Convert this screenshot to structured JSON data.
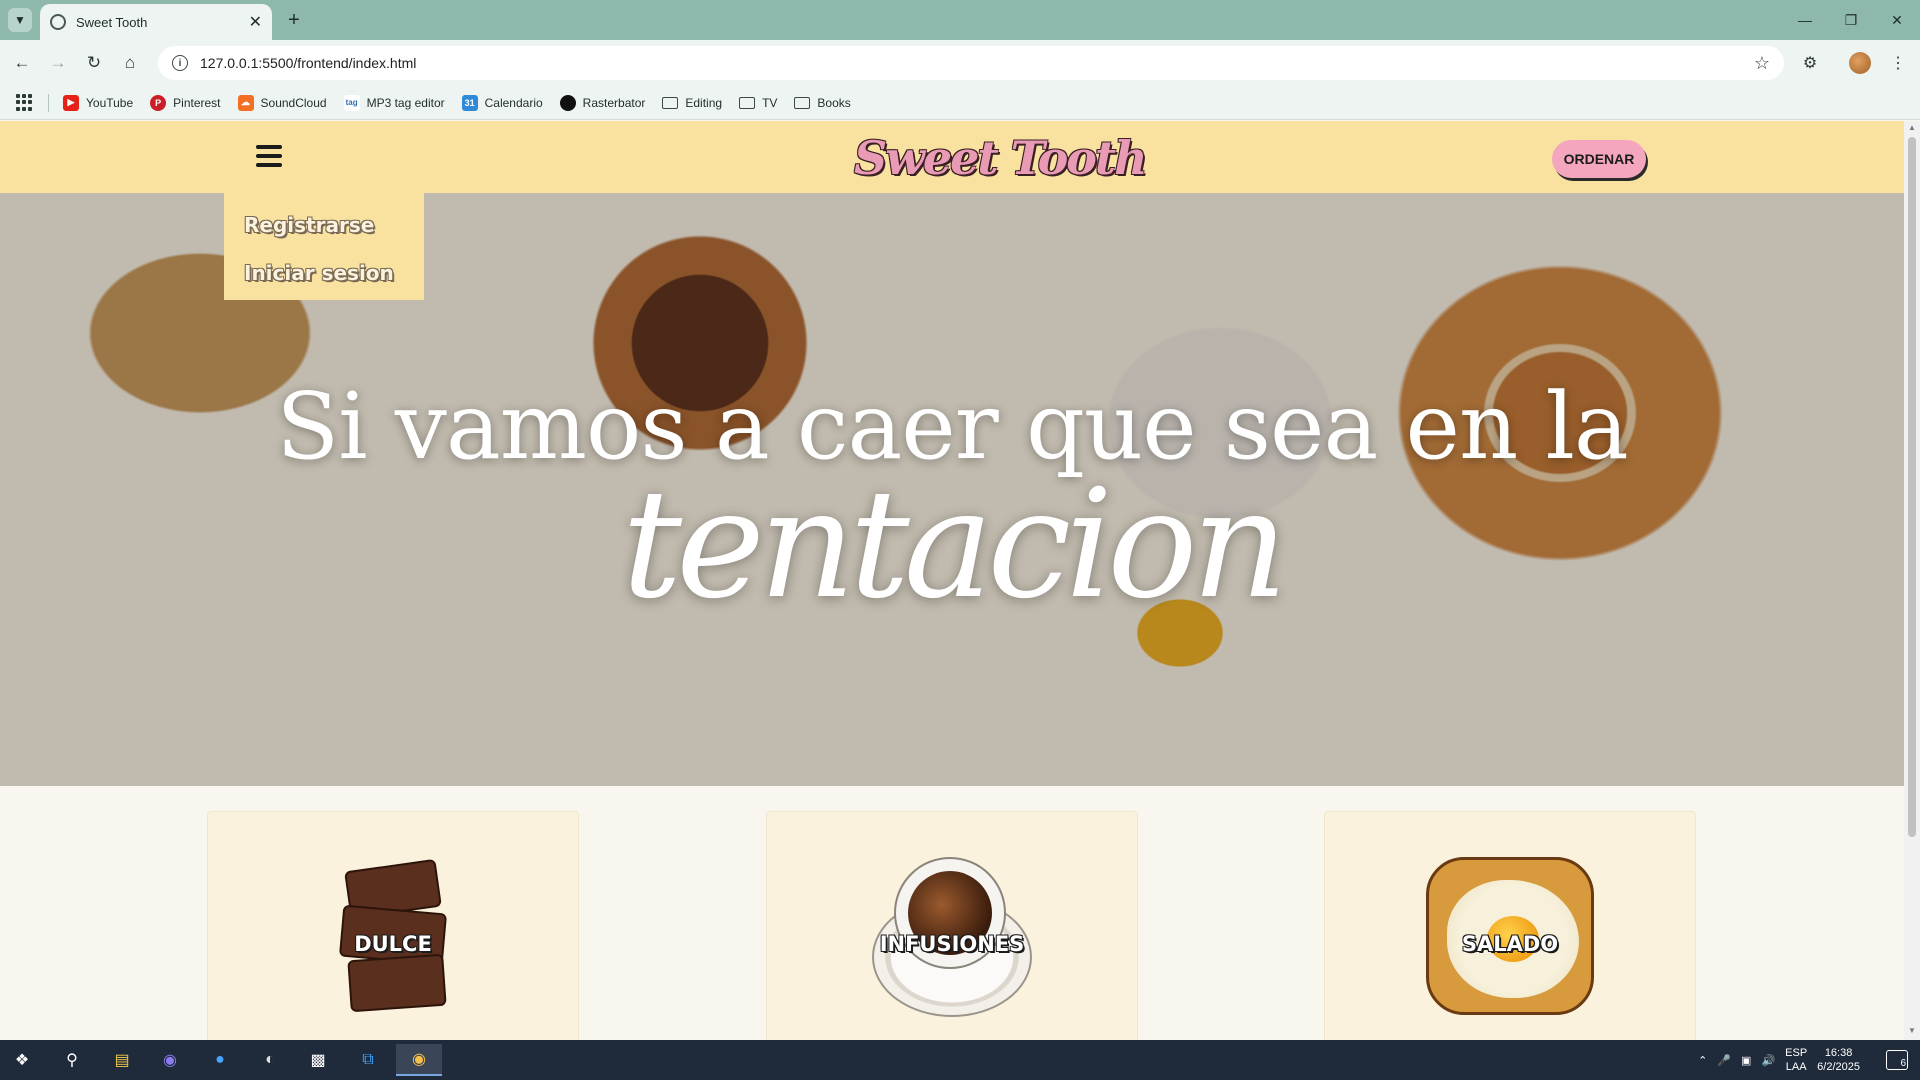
{
  "browser": {
    "tab_title": "Sweet Tooth",
    "address": "127.0.0.1:5500/frontend/index.html",
    "bookmarks": [
      {
        "label": "YouTube",
        "icon": "youtube-icon",
        "color": "#e62117"
      },
      {
        "label": "Pinterest",
        "icon": "pinterest-icon",
        "color": "#cb1f27"
      },
      {
        "label": "SoundCloud",
        "icon": "soundcloud-icon",
        "color": "#f26f23"
      },
      {
        "label": "MP3 tag editor",
        "icon": "tag-icon",
        "color": "#2f6fb5"
      },
      {
        "label": "Calendario",
        "icon": "calendar-icon",
        "color": "#2f8ad8"
      },
      {
        "label": "Rasterbator",
        "icon": "rasterbator-icon",
        "color": "#111111"
      },
      {
        "label": "Editing",
        "icon": "folder-icon"
      },
      {
        "label": "TV",
        "icon": "folder-icon"
      },
      {
        "label": "Books",
        "icon": "folder-icon"
      }
    ]
  },
  "site": {
    "logo": "Sweet Tooth",
    "order_button": "ORDENAR",
    "menu": [
      "Registrarse",
      "Iniciar sesion"
    ],
    "hero_line1": "Si vamos a caer que sea en la",
    "hero_line2": "tentacion",
    "categories": [
      {
        "label": "DULCE",
        "image": "brownie"
      },
      {
        "label": "INFUSIONES",
        "image": "coffee-cup"
      },
      {
        "label": "SALADO",
        "image": "egg-toast"
      }
    ],
    "colors": {
      "header": "#f9e1a0",
      "accent": "#f3a6bd",
      "card": "#faf2dc"
    }
  },
  "taskbar": {
    "language": [
      "ESP",
      "LAA"
    ],
    "time": "16:38",
    "date": "6/2/2025",
    "notifications": "6"
  }
}
